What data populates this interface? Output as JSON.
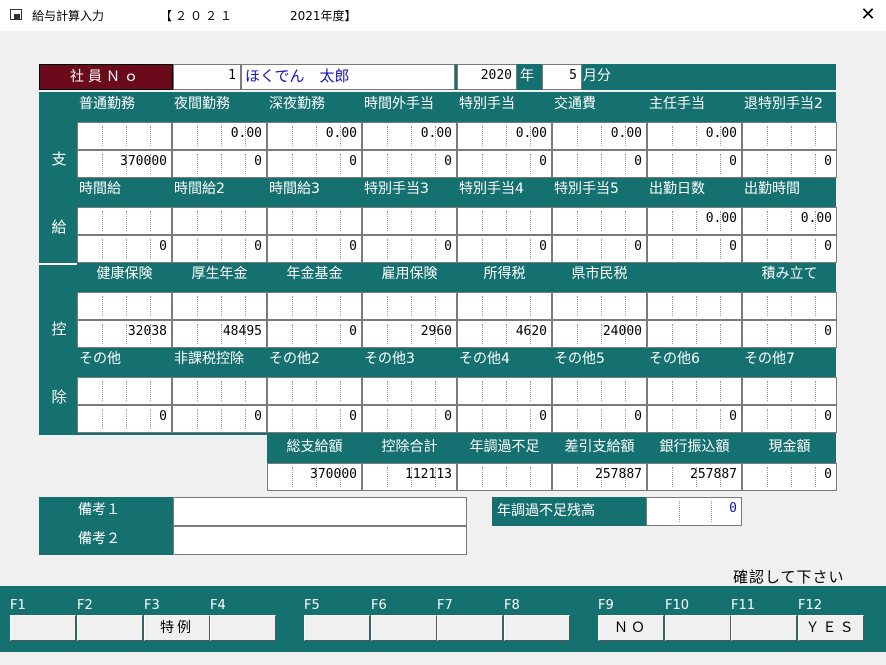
{
  "window": {
    "title_app": "給与計算入力",
    "title_year": "【２０２１",
    "title_fiscal": "2021年度】",
    "close_glyph": "✕"
  },
  "header": {
    "emp_no_label": "社員Ｎｏ",
    "emp_no": "1",
    "emp_name": "ほくでん　太郎",
    "year": "2020",
    "year_label": "年",
    "month": "5",
    "month_label": "月分"
  },
  "sections": {
    "pay": [
      "支",
      "給"
    ],
    "deduct": [
      "控",
      "除"
    ]
  },
  "pay_row1": {
    "labels": [
      "普通勤務",
      "夜間勤務",
      "深夜勤務",
      "時間外手当",
      "特別手当",
      "交通費",
      "主任手当",
      "退特別手当2"
    ],
    "top": [
      "",
      "0.00",
      "0.00",
      "0.00",
      "0.00",
      "0.00",
      "0.00",
      ""
    ],
    "bottom": [
      "370000",
      "0",
      "0",
      "0",
      "0",
      "0",
      "0",
      "0"
    ]
  },
  "pay_row2": {
    "labels": [
      "時間給",
      "時間給2",
      "時間給3",
      "特別手当3",
      "特別手当4",
      "特別手当5",
      "出勤日数",
      "出勤時間"
    ],
    "top": [
      "",
      "",
      "",
      "",
      "",
      "",
      "0.00",
      "0.00"
    ],
    "bottom": [
      "0",
      "0",
      "0",
      "0",
      "0",
      "0",
      "0",
      "0"
    ]
  },
  "deduct_row1": {
    "labels": [
      "健康保険",
      "厚生年金",
      "年金基金",
      "雇用保険",
      "所得税",
      "県市民税",
      "",
      "積み立て"
    ],
    "top": [
      "",
      "",
      "",
      "",
      "",
      "",
      "",
      ""
    ],
    "bottom": [
      "32038",
      "48495",
      "0",
      "2960",
      "4620",
      "24000",
      "",
      "0"
    ]
  },
  "deduct_row2": {
    "labels": [
      "その他",
      "非課税控除",
      "その他2",
      "その他3",
      "その他4",
      "その他5",
      "その他6",
      "その他7"
    ],
    "top": [
      "",
      "",
      "",
      "",
      "",
      "",
      "",
      ""
    ],
    "bottom": [
      "0",
      "0",
      "0",
      "0",
      "0",
      "0",
      "0",
      "0"
    ]
  },
  "totals": {
    "labels": [
      "総支給額",
      "控除合計",
      "年調過不足",
      "差引支給額",
      "銀行振込額",
      "現金額"
    ],
    "values": [
      "370000",
      "112113",
      "",
      "257887",
      "257887",
      "0"
    ]
  },
  "remarks": {
    "label1": "備考１",
    "label2": "備考２",
    "value1": "",
    "value2": ""
  },
  "adjust": {
    "label": "年調過不足残高",
    "value": "0"
  },
  "status": "確認して下さい",
  "fkeys": {
    "keys": [
      "F1",
      "F2",
      "F3",
      "F4",
      "F5",
      "F6",
      "F7",
      "F8",
      "F9",
      "F10",
      "F11",
      "F12"
    ],
    "labels": [
      "",
      "",
      "特例",
      "",
      "",
      "",
      "",
      "",
      "ＮＯ",
      "",
      "",
      "ＹＥＳ"
    ]
  },
  "colors": {
    "teal": "#157070",
    "maroon": "#6b0a1a",
    "blue_value": "#1010c0"
  }
}
